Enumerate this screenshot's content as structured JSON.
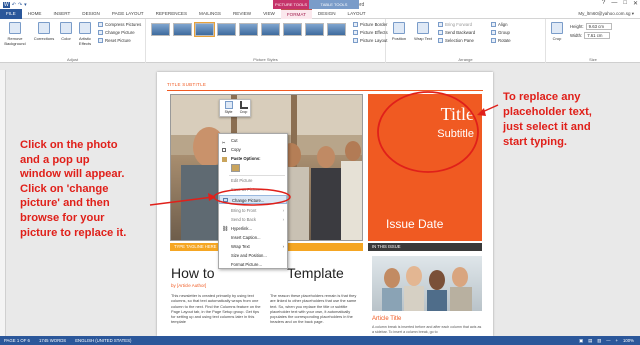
{
  "window": {
    "title": "Document1 [Compatibility Mode] - Word",
    "user": "My_ltm60@yahoo.com.sg ▾",
    "controls": [
      "?",
      "—",
      "□",
      "✕"
    ]
  },
  "qat": [
    "W",
    "↶",
    "↷",
    "▾"
  ],
  "contextual": {
    "picture_tools": "PICTURE TOOLS",
    "table_tools": "TABLE TOOLS"
  },
  "tabs": [
    "FILE",
    "HOME",
    "INSERT",
    "DESIGN",
    "PAGE LAYOUT",
    "REFERENCES",
    "MAILINGS",
    "REVIEW",
    "VIEW",
    "FORMAT",
    "DESIGN",
    "LAYOUT"
  ],
  "ribbon": {
    "remove_bg": "Remove Background",
    "corrections": "Corrections",
    "color": "Color",
    "artistic": "Artistic Effects",
    "compress": "Compress Pictures",
    "change": "Change Picture",
    "reset": "Reset Picture",
    "adjust": "Adjust",
    "picture_styles": "Picture Styles",
    "border": "Picture Border",
    "effects": "Picture Effects",
    "layout": "Picture Layout",
    "position": "Position",
    "wrap": "Wrap Text",
    "bring": "Bring Forward",
    "send": "Send Backward",
    "selection": "Selection Pane",
    "arrange": "Arrange",
    "align": "Align",
    "group": "Group",
    "rotate": "Rotate",
    "crop": "Crop",
    "height": "Height:",
    "height_val": "9.63 cm",
    "width": "Width:",
    "width_val": "7.61 cm",
    "size": "Size"
  },
  "document": {
    "title_subtitle": "TITLE SUBTITLE",
    "title": "Title",
    "subtitle": "Subtitle",
    "issue_date": "Issue Date",
    "tagline": "TYPE TAGLINE HERE",
    "in_this_issue": "IN THIS ISSUE",
    "headline_a": "How to",
    "headline_b": "Template",
    "author": "by [Article Author]",
    "body_left": "This newsletter is created primarily by using text columns, so that text automatically wraps from one column to the next. Find the Columns feature on the Page Layout tab, in the Page Setup group. Get tips for setting up and using text columns later in this template",
    "body_mid": "The reason these placeholders remain is that they are linked to other placeholders that use the same text. So, when you replace the title or subtitle placeholder text with your own, it automatically populates the corresponding placeholders in the headers and on the back page.",
    "article_title": "Article Title",
    "article_caption": "A column break is inserted before and after each column that acts as a sidebar. To insert a column break, go to"
  },
  "mini_toolbar": {
    "style": "Style",
    "crop": "Crop"
  },
  "context_menu": [
    "Cut",
    "Copy",
    "Paste Options:",
    "",
    "Edit Picture",
    "Save as Picture...",
    "Change Picture...",
    "Bring to Front",
    "Send to Back",
    "Hyperlink...",
    "Insert Caption...",
    "Wrap Text",
    "Size and Position...",
    "Format Picture..."
  ],
  "annotations": {
    "left": [
      "Click on the photo",
      "and a pop up",
      "window will appear.",
      "Click on 'change",
      "picture' and then",
      "browse for your",
      "picture to replace it."
    ],
    "right": [
      "To replace any",
      "placeholder text,",
      "just select it and",
      "start typing."
    ]
  },
  "status": [
    "PAGE 1 OF 6",
    "1745 WORDS",
    "ENGLISH (UNITED STATES)"
  ],
  "status_right": [
    "▣",
    "▤",
    "▥",
    "—",
    "+",
    "100%"
  ],
  "colors": {
    "accent": "#f05a22",
    "word_blue": "#2b579a",
    "annotation_red": "#e0201a",
    "context_pink": "#a21d4e"
  }
}
